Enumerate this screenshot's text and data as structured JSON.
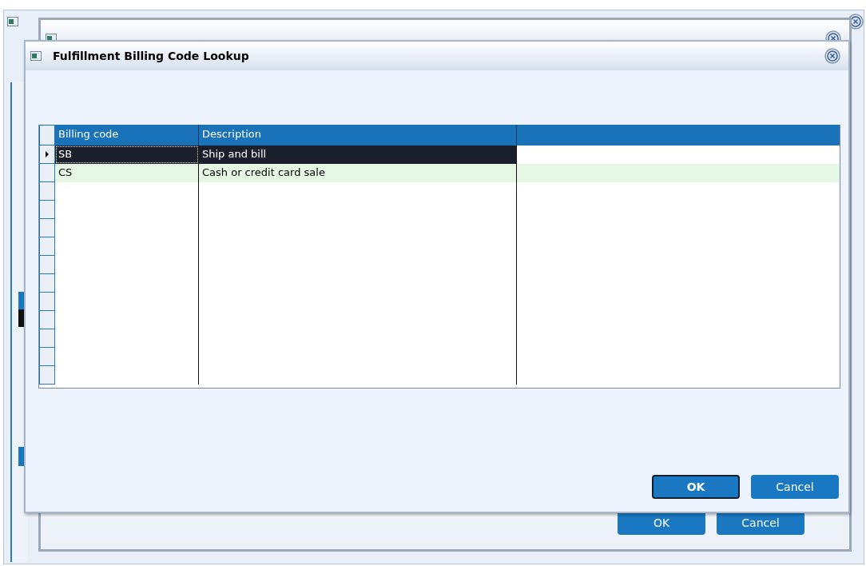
{
  "background_windows": [
    {
      "buttons": [
        {
          "label": "OK"
        },
        {
          "label": "Cancel"
        }
      ]
    }
  ],
  "dialog": {
    "title": "Fulfillment Billing Code Lookup",
    "table": {
      "columns": [
        "Billing code",
        "Description"
      ],
      "rows": [
        {
          "code": "SB",
          "description": "Ship and bill",
          "selected": true
        },
        {
          "code": "CS",
          "description": "Cash or credit card sale",
          "selected": false
        }
      ]
    },
    "buttons": [
      {
        "label": "OK",
        "default": true
      },
      {
        "label": "Cancel",
        "default": false
      }
    ]
  }
}
